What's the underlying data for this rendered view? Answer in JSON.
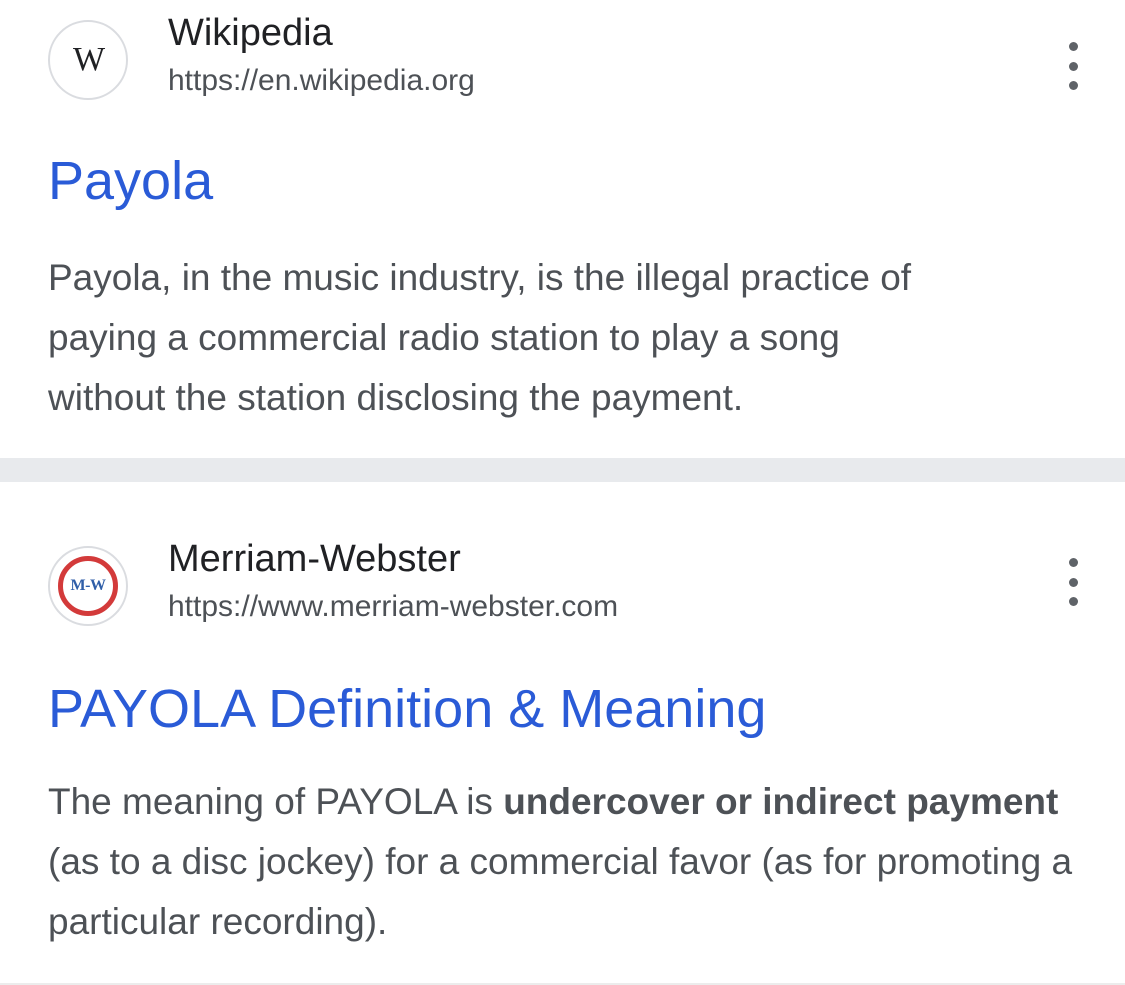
{
  "results": [
    {
      "site_name": "Wikipedia",
      "site_url": "https://en.wikipedia.org",
      "favicon_text": "W",
      "favicon_icon": "wikipedia-logo",
      "menu_icon": "more-vert-icon",
      "title": "Payola",
      "snippet_lines": [
        "Payola, in the music industry, is the illegal practice of",
        "paying a commercial radio station to play a song",
        "without the station disclosing the payment."
      ]
    },
    {
      "site_name": "Merriam-Webster",
      "site_url": "https://www.merriam-webster.com",
      "favicon_text": "M-W",
      "favicon_icon": "merriam-webster-logo",
      "menu_icon": "more-vert-icon",
      "title": "PAYOLA Definition & Meaning",
      "snippet": {
        "before": "The meaning of PAYOLA is ",
        "bold": "undercover or indirect payment",
        "after": " (as to a disc jockey) for a commercial favor (as for promoting a particular recording)."
      }
    }
  ],
  "colors": {
    "title_link": "#2a5bd7",
    "snippet_text": "#4d5156",
    "separator": "#e8eaed",
    "mw_ring": "#d33a3a",
    "mw_letters": "#2f5ea8"
  }
}
